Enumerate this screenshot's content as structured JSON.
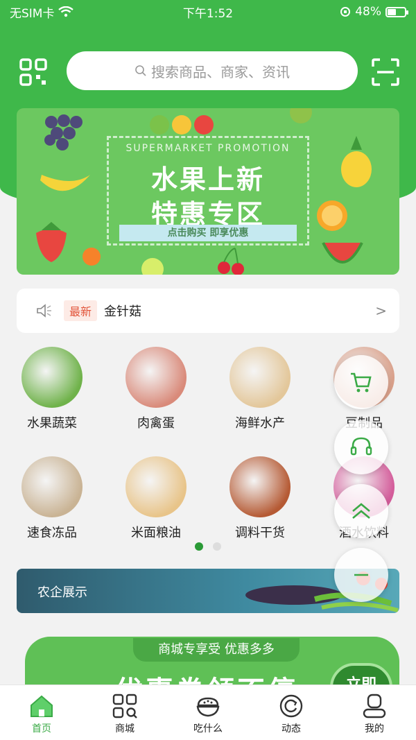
{
  "status_bar": {
    "carrier": "无SIM卡",
    "time": "下午1:52",
    "battery": "48%",
    "battery_level": 0.48
  },
  "search": {
    "placeholder": "搜索商品、商家、资讯"
  },
  "banner": {
    "en_title": "SUPERMARKET PROMOTION",
    "title_line1": "水果上新",
    "title_line2": "特惠专区",
    "subtitle": "点击购买  即享优惠"
  },
  "notice": {
    "badge": "最新",
    "text": "金针菇",
    "arrow": ">"
  },
  "categories": [
    {
      "label": "水果蔬菜",
      "color": "#6fb24a"
    },
    {
      "label": "肉禽蛋",
      "color": "#d98a7a"
    },
    {
      "label": "海鲜水产",
      "color": "#e3c79a"
    },
    {
      "label": "豆制品",
      "color": "#d9a08a"
    },
    {
      "label": "速食冻品",
      "color": "#c9b394"
    },
    {
      "label": "米面粮油",
      "color": "#e8c489"
    },
    {
      "label": "调料干货",
      "color": "#b55a34"
    },
    {
      "label": "酒水饮料",
      "color": "#d35c9a"
    }
  ],
  "promo": {
    "label": "农企展示"
  },
  "ad": {
    "tag": "商城专享受 优惠多多",
    "headline": "优惠券领不停",
    "buy": "立即"
  },
  "tabs": [
    {
      "label": "首页",
      "icon": "home-icon",
      "active": true
    },
    {
      "label": "商城",
      "icon": "mall-icon",
      "active": false
    },
    {
      "label": "吃什么",
      "icon": "bowl-icon",
      "active": false
    },
    {
      "label": "动态",
      "icon": "refresh-icon",
      "active": false
    },
    {
      "label": "我的",
      "icon": "user-icon",
      "active": false
    }
  ],
  "colors": {
    "brand": "#3fb84a",
    "active_tab": "#3aaa46"
  }
}
